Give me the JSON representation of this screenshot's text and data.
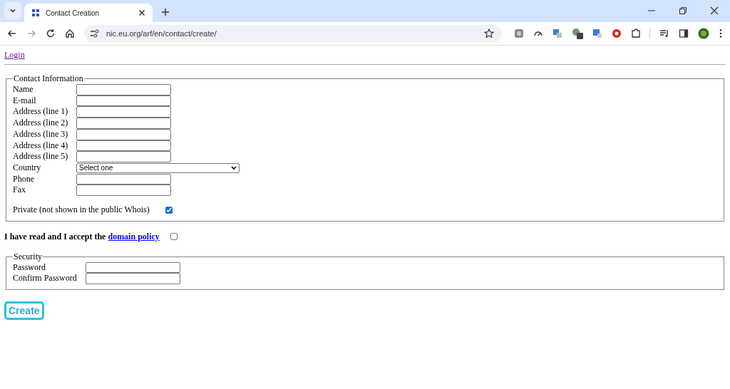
{
  "browser": {
    "tab": {
      "title": "Contact Creation",
      "selected": true
    },
    "address": "nic.eu.org/arf/en/contact/create/"
  },
  "page": {
    "login_link": "Login",
    "contact": {
      "legend": "Contact Information",
      "fields": [
        {
          "label": "Name",
          "kind": "text"
        },
        {
          "label": "E-mail",
          "kind": "text"
        },
        {
          "label": "Address (line 1)",
          "kind": "text"
        },
        {
          "label": "Address (line 2)",
          "kind": "text"
        },
        {
          "label": "Address (line 3)",
          "kind": "text"
        },
        {
          "label": "Address (line 4)",
          "kind": "text"
        },
        {
          "label": "Address (line 5)",
          "kind": "text"
        },
        {
          "label": "Country",
          "kind": "select",
          "value": "Select one"
        },
        {
          "label": "Phone",
          "kind": "text"
        },
        {
          "label": "Fax",
          "kind": "text"
        }
      ],
      "private": {
        "label": "Private (not shown in the public Whois)",
        "checked": true
      }
    },
    "policy": {
      "text": "I have read and I accept the ",
      "link": "domain policy",
      "checked": false
    },
    "security": {
      "legend": "Security",
      "fields": [
        {
          "label": "Password",
          "kind": "password"
        },
        {
          "label": "Confirm Password",
          "kind": "password"
        }
      ]
    },
    "submit": "Create"
  }
}
